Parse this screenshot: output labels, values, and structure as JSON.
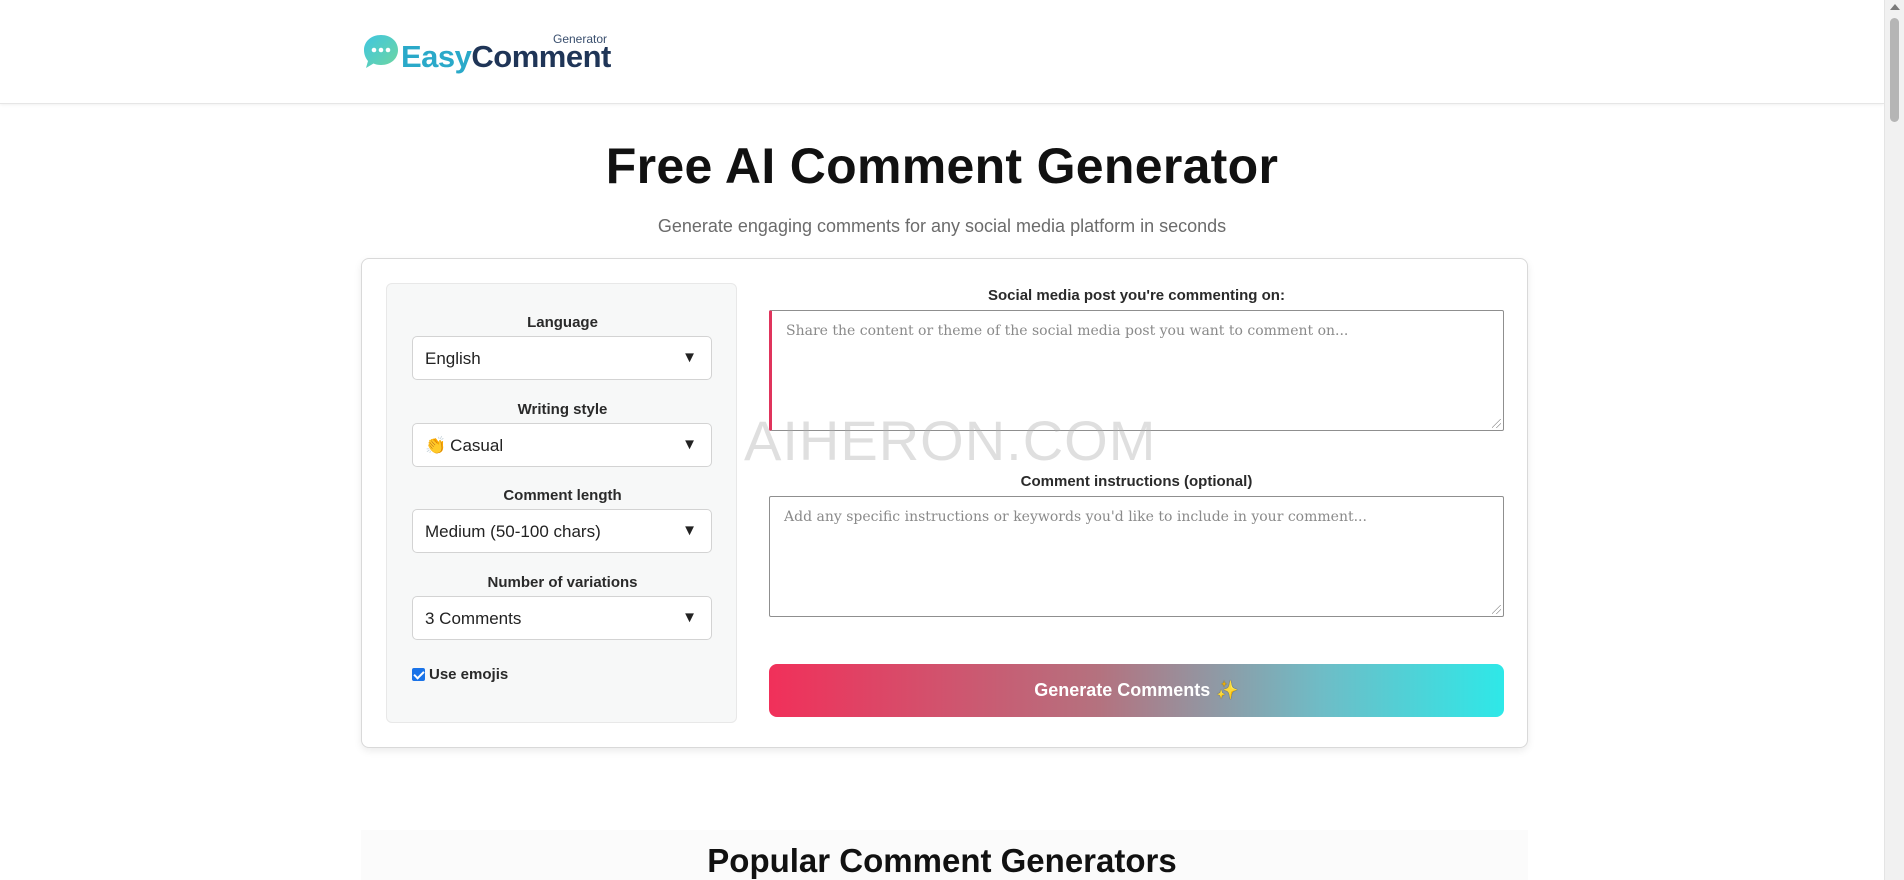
{
  "header": {
    "logo_easy": "Easy",
    "logo_comment": "Comment",
    "logo_generator": "Generator"
  },
  "hero": {
    "title": "Free AI Comment Generator",
    "subtitle": "Generate engaging comments for any social media platform in seconds"
  },
  "settings": {
    "language": {
      "label": "Language",
      "value": "English"
    },
    "writing_style": {
      "label": "Writing style",
      "value": "Casual",
      "emoji": "👏"
    },
    "comment_length": {
      "label": "Comment length",
      "value": "Medium (50-100 chars)"
    },
    "variations": {
      "label": "Number of variations",
      "value": "3 Comments"
    },
    "use_emojis": {
      "label": "Use emojis",
      "checked": true
    },
    "arrow": "▼"
  },
  "post_field": {
    "label": "Social media post you're commenting on:",
    "placeholder": "Share the content or theme of the social media post you want to comment on..."
  },
  "instructions_field": {
    "label": "Comment instructions (optional)",
    "placeholder": "Add any specific instructions or keywords you'd like to include in your comment..."
  },
  "generate_button": {
    "label": "Generate Comments",
    "icon": "sparkles-icon",
    "glyph": "✨"
  },
  "watermark": "AIHERON.COM",
  "popular": {
    "title": "Popular Comment Generators"
  },
  "colors": {
    "accent_pink": "#f1305a",
    "accent_cyan": "#2ee8e8",
    "logo_easy": "#2aa9c9",
    "logo_comment": "#1f3557"
  }
}
